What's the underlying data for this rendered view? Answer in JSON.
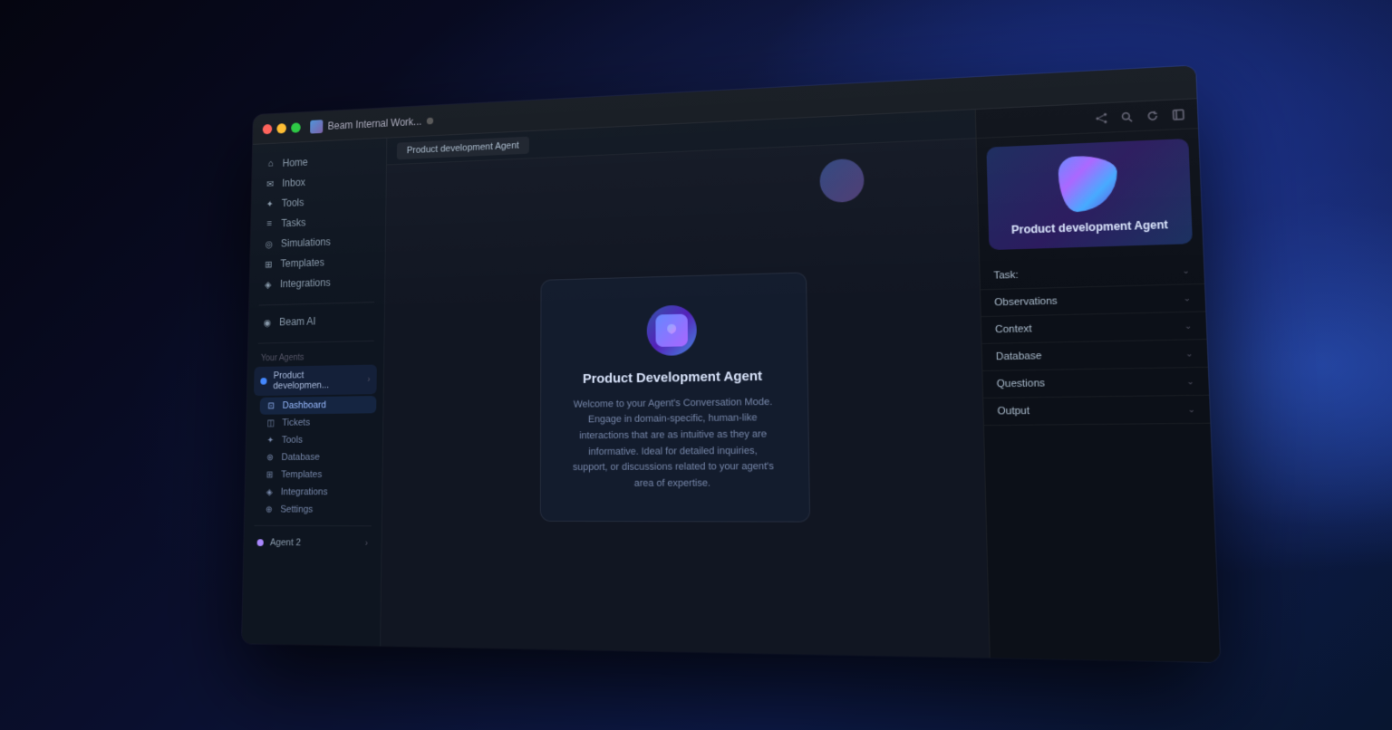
{
  "workspace": {
    "name": "Beam Internal Work...",
    "dot_color": "#888"
  },
  "tab": {
    "title": "Product development Agent"
  },
  "nav": {
    "items": [
      {
        "id": "home",
        "label": "Home",
        "icon": "home"
      },
      {
        "id": "inbox",
        "label": "Inbox",
        "icon": "inbox"
      },
      {
        "id": "tools",
        "label": "Tools",
        "icon": "tools"
      },
      {
        "id": "tasks",
        "label": "Tasks",
        "icon": "tasks"
      },
      {
        "id": "simulations",
        "label": "Simulations",
        "icon": "simulations"
      },
      {
        "id": "templates",
        "label": "Templates",
        "icon": "templates"
      },
      {
        "id": "integrations",
        "label": "Integrations",
        "icon": "integrations"
      },
      {
        "id": "beam_ai",
        "label": "Beam AI",
        "icon": "beam"
      }
    ],
    "section_label": "Your Agents",
    "agents": [
      {
        "id": "product_dev",
        "label": "Product developmen...",
        "color": "blue",
        "active": true
      },
      {
        "id": "agent2",
        "label": "Agent 2",
        "color": "purple",
        "active": false
      }
    ],
    "sub_items": [
      {
        "id": "dashboard",
        "label": "Dashboard",
        "icon": "dashboard",
        "active": true
      },
      {
        "id": "tickets",
        "label": "Tickets",
        "icon": "tickets"
      },
      {
        "id": "tools",
        "label": "Tools",
        "icon": "tools"
      },
      {
        "id": "database",
        "label": "Database",
        "icon": "database"
      },
      {
        "id": "templates",
        "label": "Templates",
        "icon": "templates"
      },
      {
        "id": "integrations",
        "label": "Integrations",
        "icon": "integrations"
      },
      {
        "id": "settings",
        "label": "Settings",
        "icon": "settings"
      }
    ]
  },
  "welcome": {
    "agent_name": "Product Development Agent",
    "description": "Welcome to your Agent's Conversation Mode. Engage in domain-specific, human-like interactions that are as intuitive as they are informative. Ideal for detailed inquiries, support, or discussions related to your agent's area of expertise."
  },
  "right_panel": {
    "agent_title": "Product development Agent",
    "task_label": "Task:",
    "sections": [
      {
        "id": "observations",
        "label": "Observations"
      },
      {
        "id": "context",
        "label": "Context"
      },
      {
        "id": "database",
        "label": "Database"
      },
      {
        "id": "questions",
        "label": "Questions"
      },
      {
        "id": "output",
        "label": "Output"
      }
    ],
    "toolbar_icons": [
      "share",
      "search",
      "refresh",
      "expand"
    ]
  }
}
